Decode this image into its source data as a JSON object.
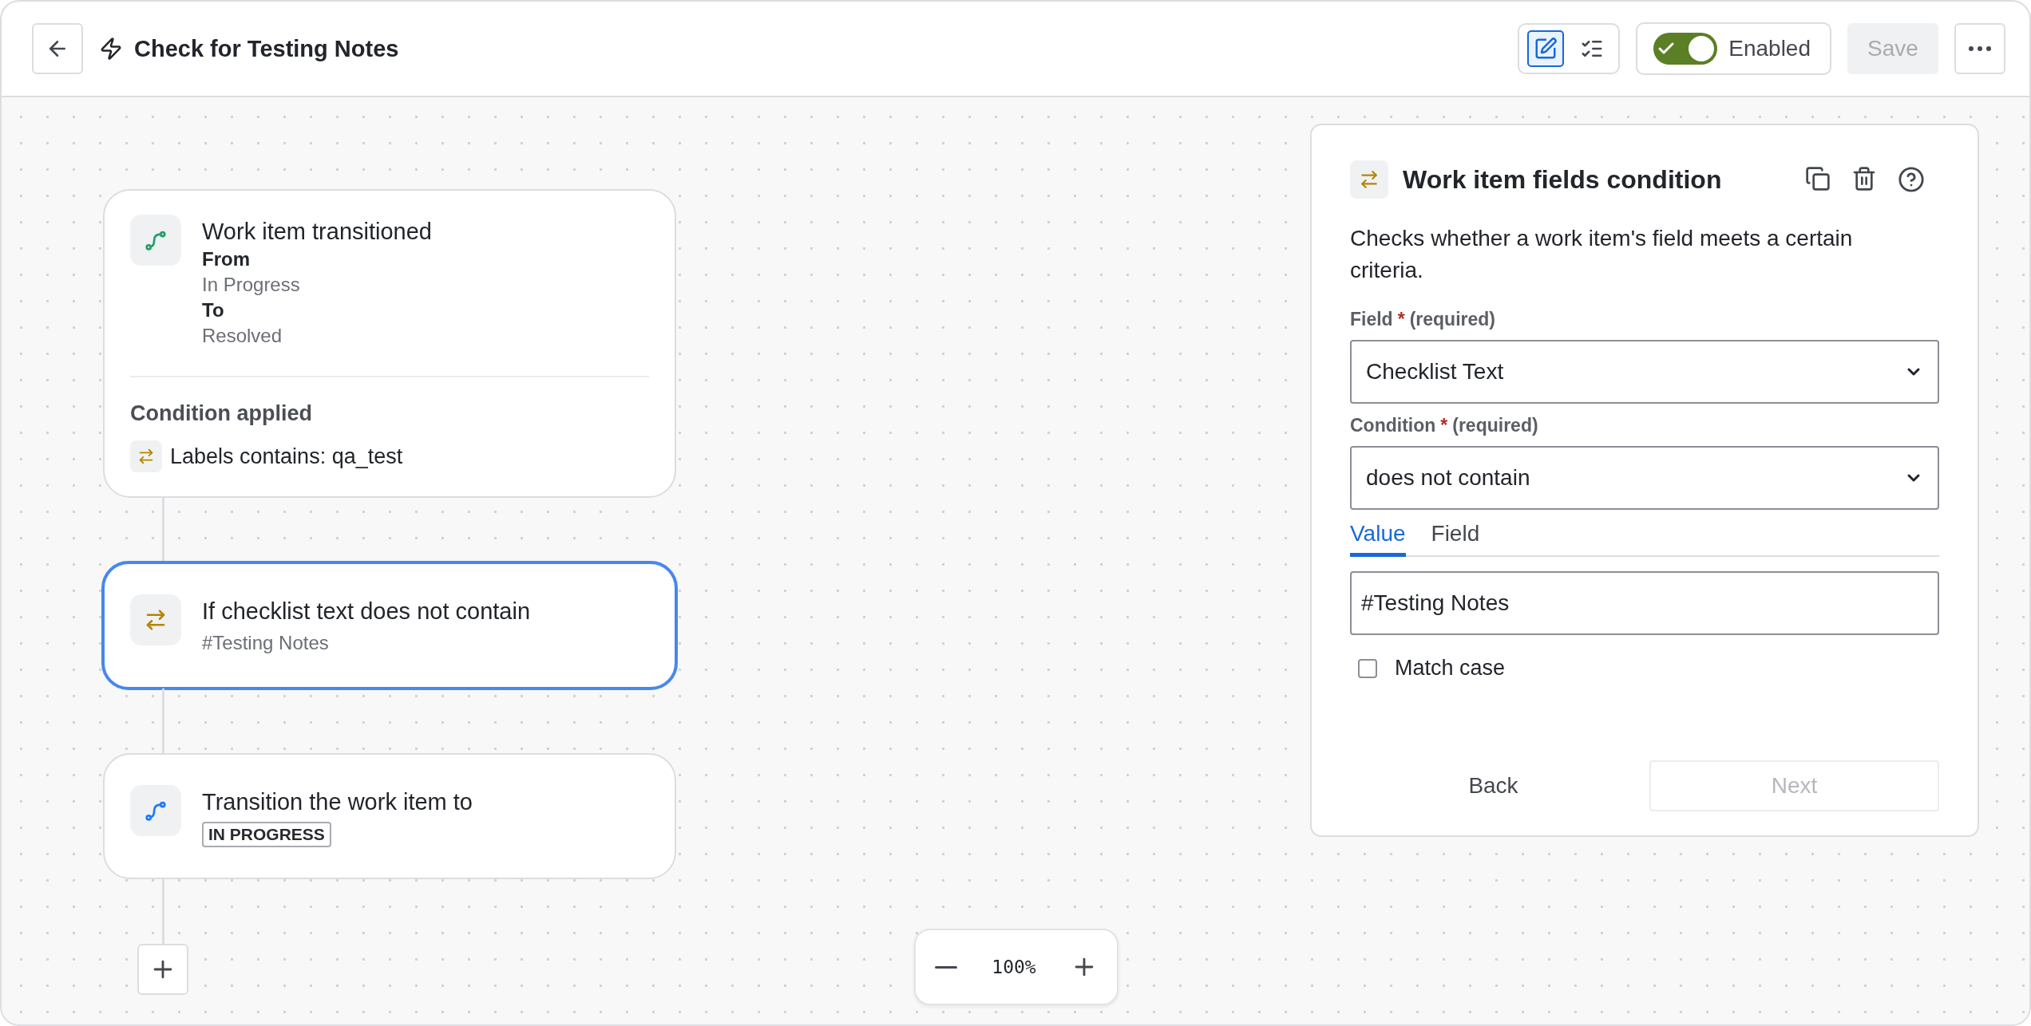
{
  "header": {
    "title": "Check for Testing Notes",
    "view_modes": [
      {
        "kind": "edit",
        "selected": true
      },
      {
        "kind": "list",
        "selected": false
      }
    ],
    "enabled_toggle": {
      "label": "Enabled",
      "on": true
    },
    "save_button": {
      "label": "Save",
      "disabled": true
    }
  },
  "flow": [
    {
      "kind": "trigger",
      "selected": false,
      "title": "Work item transitioned",
      "details": [
        {
          "label": "From",
          "value": "In Progress"
        },
        {
          "label": "To",
          "value": "Resolved"
        }
      ],
      "condition_heading": "Condition applied",
      "conditions": [
        "Labels contains: qa_test"
      ]
    },
    {
      "kind": "condition",
      "selected": true,
      "title": "If checklist text does not contain",
      "subtitle": "#Testing Notes"
    },
    {
      "kind": "action",
      "selected": false,
      "title": "Transition the work item to",
      "status": "IN PROGRESS"
    }
  ],
  "zoom": {
    "reading": "100%"
  },
  "panel": {
    "title": "Work item fields condition",
    "description": "Checks whether a work item's field meets a certain criteria.",
    "selects": [
      {
        "label": "Field",
        "required_mark": "*",
        "required_note": "(required)",
        "value": "Checklist Text"
      },
      {
        "label": "Condition",
        "required_mark": "*",
        "required_note": "(required)",
        "value": "does not contain"
      }
    ],
    "tabs": [
      {
        "label": "Value",
        "selected": true
      },
      {
        "label": "Field",
        "selected": false
      }
    ],
    "value_input": "#Testing Notes",
    "match_case": {
      "label": "Match case",
      "checked": false
    },
    "back_button": {
      "label": "Back"
    },
    "next_button": {
      "label": "Next",
      "disabled": true
    }
  }
}
